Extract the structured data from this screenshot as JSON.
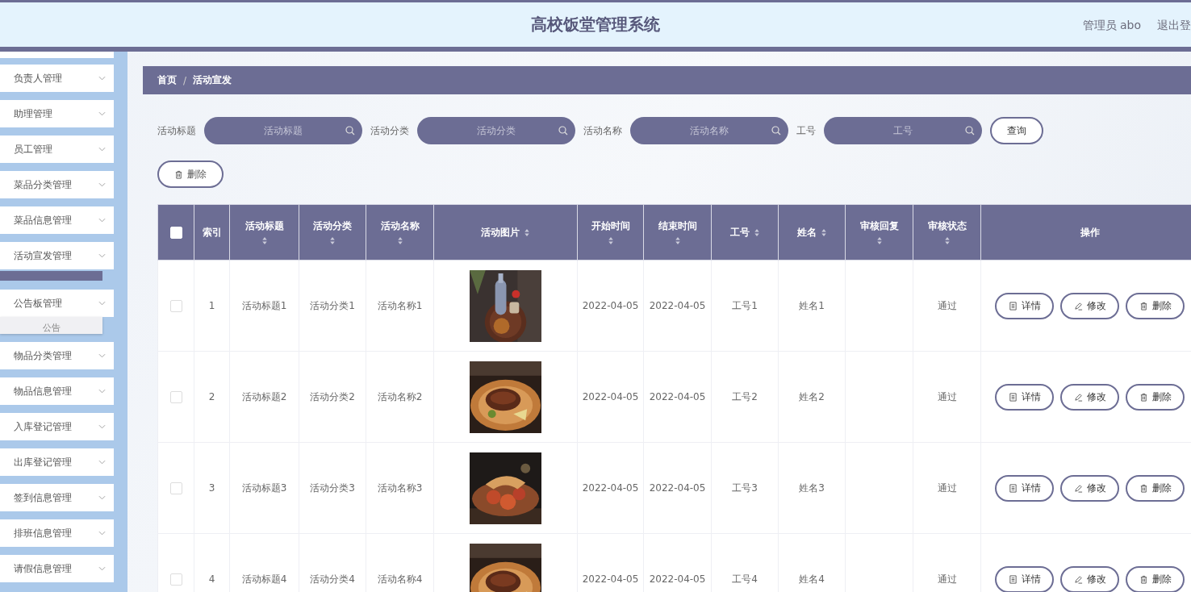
{
  "header": {
    "title": "高校饭堂管理系统",
    "user": "管理员 abo",
    "logout": "退出登"
  },
  "sidebar": {
    "items": [
      {
        "label": "负责人管理"
      },
      {
        "label": "助理管理"
      },
      {
        "label": "员工管理"
      },
      {
        "label": "菜品分类管理"
      },
      {
        "label": "菜品信息管理"
      },
      {
        "label": "活动宣发管理",
        "children": [
          {
            "selected": true
          }
        ]
      },
      {
        "label": "公告板管理",
        "children": [
          {
            "label": "公告",
            "selected": false
          }
        ]
      },
      {
        "label": "物品分类管理"
      },
      {
        "label": "物品信息管理"
      },
      {
        "label": "入库登记管理"
      },
      {
        "label": "出库登记管理"
      },
      {
        "label": "签到信息管理"
      },
      {
        "label": "排班信息管理"
      },
      {
        "label": "请假信息管理"
      }
    ]
  },
  "breadcrumb": [
    "首页",
    "/",
    "活动宣发"
  ],
  "search": [
    {
      "label": "活动标题",
      "placeholder": "活动标题"
    },
    {
      "label": "活动分类",
      "placeholder": "活动分类"
    },
    {
      "label": "活动名称",
      "placeholder": "活动名称"
    },
    {
      "label": "工号",
      "placeholder": "工号"
    }
  ],
  "query_button": "查询",
  "delete_button": "删除",
  "table": {
    "columns": [
      {
        "kind": "checkbox",
        "checked": false
      },
      {
        "kind": "text",
        "label": "索引",
        "sortable": false
      },
      {
        "kind": "text",
        "label": "活动标题",
        "sortable": true
      },
      {
        "kind": "text",
        "label": "活动分类",
        "sortable": true
      },
      {
        "kind": "text",
        "label": "活动名称",
        "sortable": true
      },
      {
        "kind": "text",
        "label": "活动图片",
        "sortable": true
      },
      {
        "kind": "text",
        "label": "开始时间",
        "sortable": true
      },
      {
        "kind": "text",
        "label": "结束时间",
        "sortable": true
      },
      {
        "kind": "text",
        "label": "工号",
        "sortable": true
      },
      {
        "kind": "text",
        "label": "姓名",
        "sortable": true
      },
      {
        "kind": "text",
        "label": "审核回复",
        "sortable": true
      },
      {
        "kind": "text",
        "label": "审核状态",
        "sortable": true
      },
      {
        "kind": "text",
        "label": "操作",
        "sortable": false
      }
    ],
    "rows": [
      {
        "checked": false,
        "index": "1",
        "title": "活动标题1",
        "category": "活动分类1",
        "name": "活动名称1",
        "image": {
          "kind": "picture"
        },
        "start": "2022-04-05",
        "end": "2022-04-05",
        "staff_no": "工号1",
        "person": "姓名1",
        "status": "通过",
        "actions": [
          {
            "kind": "detail",
            "label": "详情"
          },
          {
            "kind": "edit",
            "label": "修改"
          },
          {
            "kind": "delete",
            "label": "删除"
          }
        ]
      },
      {
        "checked": false,
        "index": "2",
        "title": "活动标题2",
        "category": "活动分类2",
        "name": "活动名称2",
        "image": {
          "kind": "picture"
        },
        "start": "2022-04-05",
        "end": "2022-04-05",
        "staff_no": "工号2",
        "person": "姓名2",
        "status": "通过",
        "actions": [
          {
            "kind": "detail",
            "label": "详情"
          },
          {
            "kind": "edit",
            "label": "修改"
          },
          {
            "kind": "delete",
            "label": "删除"
          }
        ]
      },
      {
        "checked": false,
        "index": "3",
        "title": "活动标题3",
        "category": "活动分类3",
        "name": "活动名称3",
        "image": {
          "kind": "picture"
        },
        "start": "2022-04-05",
        "end": "2022-04-05",
        "staff_no": "工号3",
        "person": "姓名3",
        "status": "通过",
        "actions": [
          {
            "kind": "detail",
            "label": "详情"
          },
          {
            "kind": "edit",
            "label": "修改"
          },
          {
            "kind": "delete",
            "label": "删除"
          }
        ]
      },
      {
        "checked": false,
        "index": "4",
        "title": "活动标题4",
        "category": "活动分类4",
        "name": "活动名称4",
        "image": {
          "kind": "picture"
        },
        "start": "2022-04-05",
        "end": "2022-04-05",
        "staff_no": "工号4",
        "person": "姓名4",
        "status": "通过",
        "actions": [
          {
            "kind": "detail",
            "label": "详情"
          },
          {
            "kind": "edit",
            "label": "修改"
          },
          {
            "kind": "delete",
            "label": "删除"
          }
        ]
      }
    ]
  }
}
